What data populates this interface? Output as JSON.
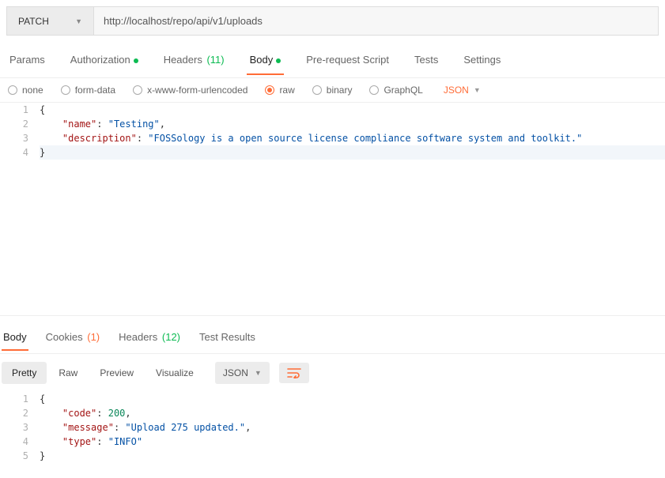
{
  "request": {
    "method": "PATCH",
    "url": "http://localhost/repo/api/v1/uploads"
  },
  "tabs": {
    "params": "Params",
    "authorization": "Authorization",
    "headers": "Headers",
    "headers_count": "(11)",
    "body": "Body",
    "prerequest": "Pre-request Script",
    "tests": "Tests",
    "settings": "Settings"
  },
  "body_types": {
    "none": "none",
    "formdata": "form-data",
    "xwww": "x-www-form-urlencoded",
    "raw": "raw",
    "binary": "binary",
    "graphql": "GraphQL",
    "format": "JSON"
  },
  "request_body": {
    "line1_num": "1",
    "line2_num": "2",
    "line3_num": "3",
    "line4_num": "4",
    "brace_open": "{",
    "brace_close": "}",
    "name_key": "\"name\"",
    "name_val": "\"Testing\"",
    "desc_key": "\"description\"",
    "desc_val": "\"FOSSology is a open source license compliance software system and toolkit.\""
  },
  "response_tabs": {
    "body": "Body",
    "cookies": "Cookies",
    "cookies_count": "(1)",
    "headers": "Headers",
    "headers_count": "(12)",
    "testresults": "Test Results"
  },
  "view_modes": {
    "pretty": "Pretty",
    "raw": "Raw",
    "preview": "Preview",
    "visualize": "Visualize",
    "lang": "JSON"
  },
  "response_body": {
    "l1": "1",
    "l2": "2",
    "l3": "3",
    "l4": "4",
    "l5": "5",
    "brace_open": "{",
    "brace_close": "}",
    "code_key": "\"code\"",
    "code_val": "200",
    "message_key": "\"message\"",
    "message_val": "\"Upload 275 updated.\"",
    "type_key": "\"type\"",
    "type_val": "\"INFO\""
  }
}
